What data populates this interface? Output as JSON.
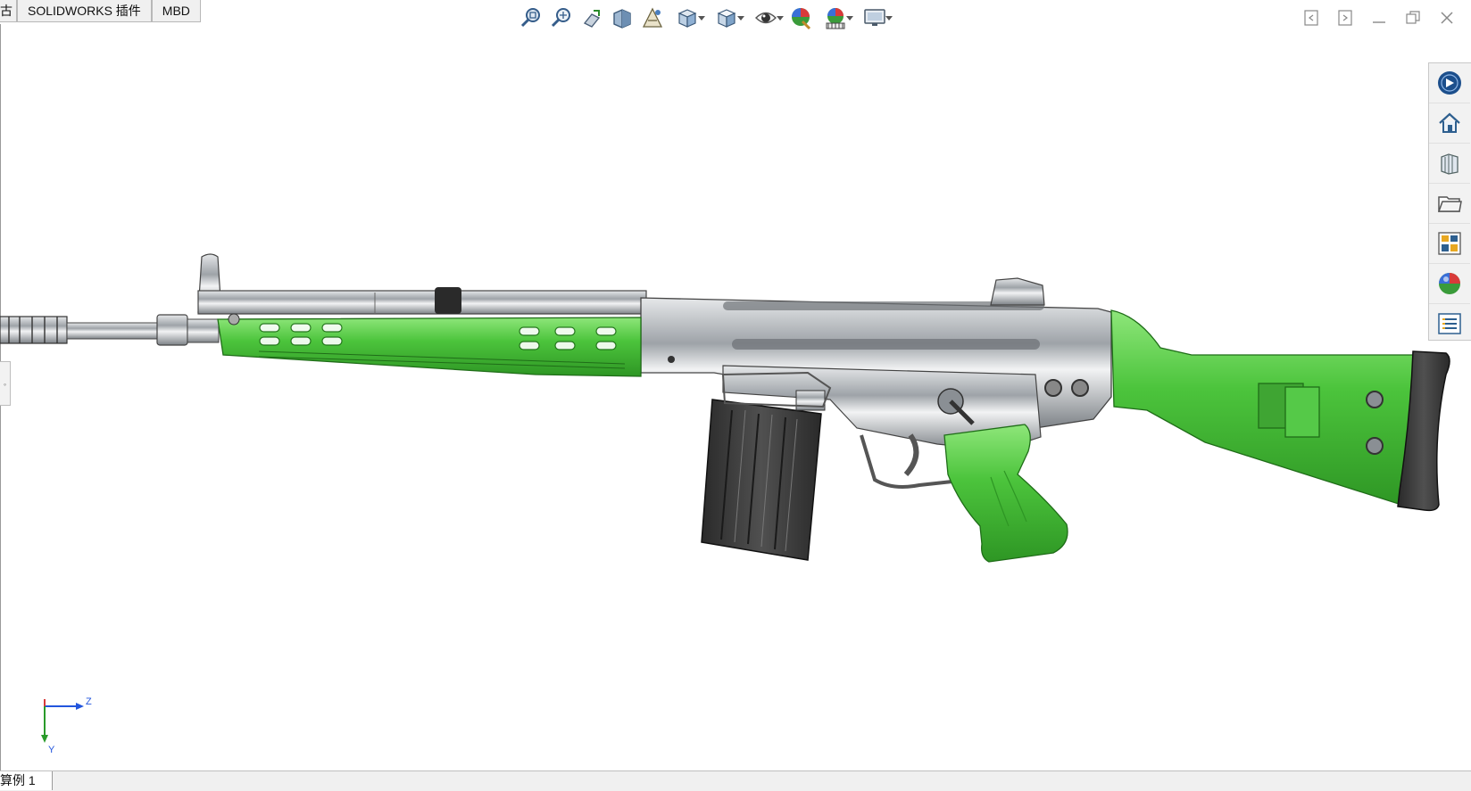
{
  "command_tabs": [
    "古",
    "SOLIDWORKS 插件",
    "MBD"
  ],
  "hud_icons": [
    {
      "name": "zoom-to-fit-icon",
      "dropdown": false
    },
    {
      "name": "zoom-to-area-icon",
      "dropdown": false
    },
    {
      "name": "previous-view-icon",
      "dropdown": false
    },
    {
      "name": "section-view-icon",
      "dropdown": false
    },
    {
      "name": "dynamic-annotation-view-icon",
      "dropdown": false
    },
    {
      "name": "view-orientation-icon",
      "dropdown": true
    },
    {
      "name": "display-style-icon",
      "dropdown": true
    },
    {
      "name": "hide-show-items-icon",
      "dropdown": true
    },
    {
      "name": "edit-appearance-icon",
      "dropdown": false
    },
    {
      "name": "apply-scene-icon",
      "dropdown": true
    },
    {
      "name": "view-settings-icon",
      "dropdown": true
    }
  ],
  "window_controls": [
    "tile-left-icon",
    "tile-right-icon",
    "minimize-icon",
    "restore-icon",
    "close-icon"
  ],
  "task_pane": [
    "solidworks-resources-icon",
    "home-icon",
    "design-library-icon",
    "file-explorer-icon",
    "view-palette-icon",
    "appearances-scenes-icon",
    "custom-properties-icon"
  ],
  "triad": {
    "axis_z": "Z",
    "axis_y": "Y"
  },
  "bottom_tab": "算例 1",
  "colors": {
    "green": "#4cc43c",
    "steel": "#b8bcc0",
    "dark": "#3a3a3a",
    "accent": "#2255dd"
  }
}
